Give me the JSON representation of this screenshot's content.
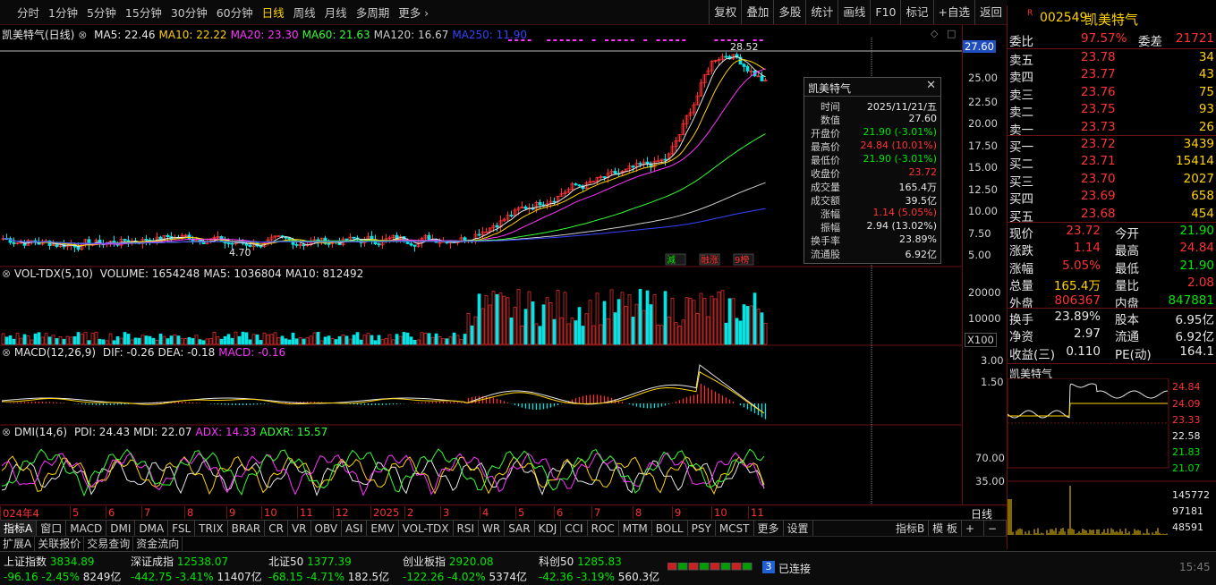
{
  "periods": [
    "分时",
    "1分钟",
    "5分钟",
    "15分钟",
    "30分钟",
    "60分钟",
    "日线",
    "周线",
    "月线",
    "多周期",
    "更多 ›"
  ],
  "active_period": "日线",
  "tools": [
    "复权",
    "叠加",
    "多股",
    "统计",
    "画线",
    "F10",
    "标记",
    "+自选",
    "返回"
  ],
  "chart_header": {
    "name": "凯美特气(日线)",
    "ma": [
      {
        "label": "MA5: 22.46",
        "color": "#e6e6e6"
      },
      {
        "label": "MA10: 22.22",
        "color": "#ffd200"
      },
      {
        "label": "MA20: 23.30",
        "color": "#ff33ff"
      },
      {
        "label": "MA60: 21.63",
        "color": "#33ff33"
      },
      {
        "label": "MA120: 16.67",
        "color": "#cccccc"
      },
      {
        "label": "MA250: 11.90",
        "color": "#3344ff"
      }
    ]
  },
  "price_axis": [
    "27.60",
    "25.00",
    "22.50",
    "20.00",
    "17.50",
    "15.00",
    "12.50",
    "10.00",
    "7.50",
    "5.00"
  ],
  "annotations": {
    "high": "28.52",
    "low": "4.70"
  },
  "tags": [
    "減",
    "融涨",
    "9榜"
  ],
  "vol_header": {
    "name": "VOL-TDX(5,10)",
    "items": [
      {
        "label": "VOLUME: 1654248",
        "color": "#e6e6e6"
      },
      {
        "label": "MA5: 1036804",
        "color": "#e6e6e6"
      },
      {
        "label": "MA10: 812492",
        "color": "#e6e6e6"
      }
    ]
  },
  "vol_axis": [
    "20000",
    "10000",
    "X100"
  ],
  "macd_header": {
    "name": "MACD(12,26,9)",
    "items": [
      {
        "label": "DIF: -0.26",
        "color": "#e6e6e6"
      },
      {
        "label": "DEA: -0.18",
        "color": "#e6e6e6"
      },
      {
        "label": "MACD: -0.16",
        "color": "#ff33ff"
      }
    ]
  },
  "macd_axis": [
    "3.00",
    "1.50"
  ],
  "dmi_header": {
    "name": "DMI(14,6)",
    "items": [
      {
        "label": "PDI: 24.43",
        "color": "#e6e6e6"
      },
      {
        "label": "MDI: 22.07",
        "color": "#e6e6e6"
      },
      {
        "label": "ADX: 14.33",
        "color": "#ff33ff"
      },
      {
        "label": "ADXR: 15.57",
        "color": "#33ff33"
      }
    ]
  },
  "dmi_axis": [
    "70.00",
    "35.00"
  ],
  "time_axis": [
    "024年4",
    "5",
    "6",
    "7",
    "8",
    "9",
    "10",
    "11",
    "12",
    "2025",
    "2",
    "3",
    "4",
    "5",
    "6",
    "7",
    "8",
    "9",
    "10",
    "11"
  ],
  "time_axis_right": "日线",
  "indicators": [
    "指标A",
    "窗口",
    "MACD",
    "DMI",
    "DMA",
    "FSL",
    "TRIX",
    "BRAR",
    "CR",
    "VR",
    "OBV",
    "ASI",
    "EMV",
    "VOL-TDX",
    "RSI",
    "WR",
    "SAR",
    "KDJ",
    "CCI",
    "ROC",
    "MTM",
    "BOLL",
    "PSY",
    "MCST",
    "更多",
    "设置"
  ],
  "indicators_right": [
    "指标B",
    "模 板",
    "+",
    "−"
  ],
  "subtabs": [
    "扩展A",
    "关联报价",
    "交易查询",
    "资金流向"
  ],
  "tooltip": {
    "title": "凯美特气",
    "rows": [
      {
        "k": "时间",
        "v": "2025/11/21/五",
        "c": "#e6e6e6"
      },
      {
        "k": "数值",
        "v": "27.60",
        "c": "#e6e6e6"
      },
      {
        "k": "开盘价",
        "v": "21.90 (-3.01%)",
        "c": "#00e600"
      },
      {
        "k": "最高价",
        "v": "24.84 (10.01%)",
        "c": "#ff3232"
      },
      {
        "k": "最低价",
        "v": "21.90 (-3.01%)",
        "c": "#00e600"
      },
      {
        "k": "收盘价",
        "v": "23.72",
        "c": "#ff3232"
      },
      {
        "k": "成交量",
        "v": "165.4万",
        "c": "#e6e6e6"
      },
      {
        "k": "成交额",
        "v": "39.5亿",
        "c": "#e6e6e6"
      },
      {
        "k": "涨幅",
        "v": "1.14 (5.05%)",
        "c": "#ff3232"
      },
      {
        "k": "振幅",
        "v": "2.94 (13.02%)",
        "c": "#e6e6e6"
      },
      {
        "k": "换手率",
        "v": "23.89%",
        "c": "#e6e6e6"
      },
      {
        "k": "流通股",
        "v": "6.92亿",
        "c": "#e6e6e6"
      }
    ]
  },
  "quote": {
    "code": "002549",
    "name": "凯美特气",
    "wb_label": "委比",
    "wb": "97.57%",
    "wc_label": "委差",
    "wc": "21721",
    "asks": [
      {
        "l": "卖五",
        "p": "23.78",
        "v": "34"
      },
      {
        "l": "卖四",
        "p": "23.77",
        "v": "43"
      },
      {
        "l": "卖三",
        "p": "23.76",
        "v": "75"
      },
      {
        "l": "卖二",
        "p": "23.75",
        "v": "93"
      },
      {
        "l": "卖一",
        "p": "23.73",
        "v": "26"
      }
    ],
    "bids": [
      {
        "l": "买一",
        "p": "23.72",
        "v": "3439"
      },
      {
        "l": "买二",
        "p": "23.71",
        "v": "15414"
      },
      {
        "l": "买三",
        "p": "23.70",
        "v": "2027"
      },
      {
        "l": "买四",
        "p": "23.69",
        "v": "658"
      },
      {
        "l": "买五",
        "p": "23.68",
        "v": "454"
      }
    ],
    "stats": [
      {
        "l1": "现价",
        "v1": "23.72",
        "c1": "#ff3232",
        "l2": "今开",
        "v2": "21.90",
        "c2": "#00e600"
      },
      {
        "l1": "涨跌",
        "v1": "1.14",
        "c1": "#ff3232",
        "l2": "最高",
        "v2": "24.84",
        "c2": "#ff3232"
      },
      {
        "l1": "涨幅",
        "v1": "5.05%",
        "c1": "#ff3232",
        "l2": "最低",
        "v2": "21.90",
        "c2": "#00e600"
      },
      {
        "l1": "总量",
        "v1": "165.4万",
        "c1": "#ffd200",
        "l2": "量比",
        "v2": "2.08",
        "c2": "#ff3232"
      },
      {
        "l1": "外盘",
        "v1": "806367",
        "c1": "#ff3232",
        "l2": "内盘",
        "v2": "847881",
        "c2": "#00e600"
      }
    ],
    "stats2": [
      {
        "l1": "换手",
        "v1": "23.89%",
        "l2": "股本",
        "v2": "6.95亿"
      },
      {
        "l1": "净资",
        "v1": "2.97",
        "l2": "流通",
        "v2": "6.92亿"
      },
      {
        "l1": "收益(三)",
        "v1": "0.110",
        "l2": "PE(动)",
        "v2": "164.1"
      }
    ],
    "mini_title": "凯美特气",
    "mini_price_axis": [
      "24.84",
      "24.09",
      "23.33",
      "22.58",
      "21.83",
      "21.07"
    ],
    "mini_vol_axis": [
      "145772",
      "97181",
      "48591"
    ]
  },
  "status": {
    "indices": [
      {
        "name": "上证指数",
        "val": "3834.89",
        "chg": "-96.16",
        "pct": "-2.45%",
        "amt": "8249亿"
      },
      {
        "name": "深证成指",
        "val": "12538.07",
        "chg": "-442.75",
        "pct": "-3.41%",
        "amt": "11407亿"
      },
      {
        "name": "北证50",
        "val": "1377.39",
        "chg": "-68.15",
        "pct": "-4.71%",
        "amt": "182.5亿"
      },
      {
        "name": "创业板指",
        "val": "2920.08",
        "chg": "-122.26",
        "pct": "-4.02%",
        "amt": "5374亿"
      },
      {
        "name": "科创50",
        "val": "1285.83",
        "chg": "-42.36",
        "pct": "-3.19%",
        "amt": "560.3亿"
      }
    ],
    "conn_count": "3",
    "conn_text": "已连接",
    "clock": "15:45"
  },
  "colors": {
    "up": "#ff3232",
    "down": "#00e600",
    "grid": "#6b1111",
    "accent": "#ffd200"
  }
}
